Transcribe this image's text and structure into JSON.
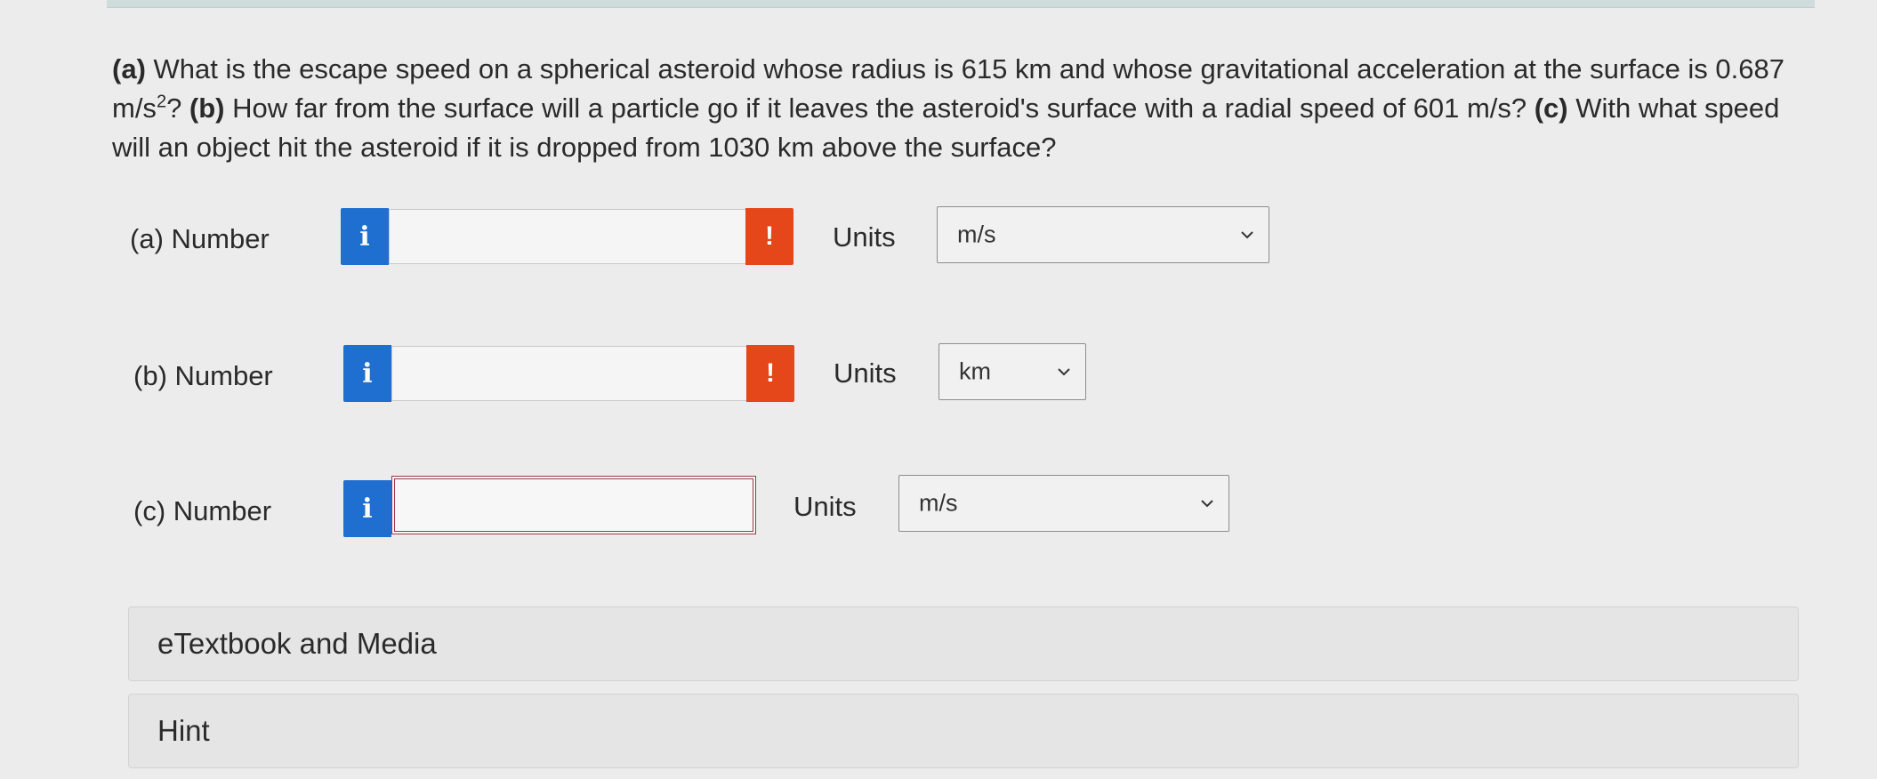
{
  "question": {
    "part_a_tag": "(a)",
    "part_a_text": " What is the escape speed on a spherical asteroid whose radius is 615 km and whose gravitational acceleration at the surface is 0.687 m/s",
    "superscript": "2",
    "part_a_end": "? ",
    "part_b_tag": "(b)",
    "part_b_text": " How far from the surface will a particle go if it leaves the asteroid's surface with a radial speed of 601 m/s? ",
    "part_c_tag": "(c)",
    "part_c_text": " With what speed will an object hit the asteroid if it is dropped from 1030 km above the surface?"
  },
  "rows": {
    "a": {
      "label": "(a)   Number",
      "info_icon": "i",
      "value": "",
      "error_icon": "!",
      "units_label": "Units",
      "unit": "m/s"
    },
    "b": {
      "label": "(b)   Number",
      "info_icon": "i",
      "value": "",
      "error_icon": "!",
      "units_label": "Units",
      "unit": "km"
    },
    "c": {
      "label": "(c)   Number",
      "info_icon": "i",
      "value": "",
      "units_label": "Units",
      "unit": "m/s"
    }
  },
  "panels": {
    "etextbook": "eTextbook and Media",
    "hint": "Hint"
  },
  "colors": {
    "info": "#1f6fd0",
    "error": "#e5461a",
    "active_border": "#9b3a4a"
  }
}
